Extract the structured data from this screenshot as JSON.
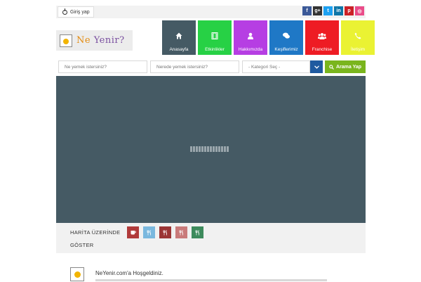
{
  "topbar": {
    "login_label": "Giriş yap",
    "social": [
      {
        "name": "facebook",
        "glyph": "f",
        "color": "#3b5998"
      },
      {
        "name": "google-plus",
        "glyph": "g+",
        "color": "#333333"
      },
      {
        "name": "twitter",
        "glyph": "t",
        "color": "#1da1f2"
      },
      {
        "name": "linkedin",
        "glyph": "in",
        "color": "#0e76a8"
      },
      {
        "name": "pinterest",
        "glyph": "p",
        "color": "#cb2027"
      },
      {
        "name": "dribbble",
        "glyph": "◎",
        "color": "#ea4c89"
      }
    ]
  },
  "logo": {
    "ne": "Ne",
    "yenir": "Yenir?"
  },
  "nav": [
    {
      "label": "Anasayfa",
      "icon": "home-icon",
      "color": "#455a64"
    },
    {
      "label": "Etkinlikler",
      "icon": "film-icon",
      "color": "#27d145"
    },
    {
      "label": "Hakkımızda",
      "icon": "user-icon",
      "color": "#b63ee3"
    },
    {
      "label": "Keşiflerimiz",
      "icon": "chat-icon",
      "color": "#1f78c6"
    },
    {
      "label": "Franchise",
      "icon": "group-icon",
      "color": "#ee1c24"
    },
    {
      "label": "İletişim",
      "icon": "phone-icon",
      "color": "#eaf233"
    }
  ],
  "search": {
    "what_placeholder": "Ne yemek istersiniz?",
    "where_placeholder": "Nerede yemek istersiniz?",
    "category_selected": "- Kategori Seç -",
    "button_label": "Arama Yap"
  },
  "filter": {
    "label_line1": "HARİTA ÜZERİNDE",
    "label_line2": "GÖSTER",
    "categories": [
      {
        "icon": "cup-icon",
        "color": "#b03a3a"
      },
      {
        "icon": "cutlery-icon",
        "color": "#7ab8de"
      },
      {
        "icon": "cutlery-icon",
        "color": "#9b3535"
      },
      {
        "icon": "cutlery-icon",
        "color": "#c97a7a"
      },
      {
        "icon": "cutlery-icon",
        "color": "#3d8a5c"
      }
    ]
  },
  "welcome": {
    "title": "NeYenir.com'a Hoşgeldiniz."
  }
}
